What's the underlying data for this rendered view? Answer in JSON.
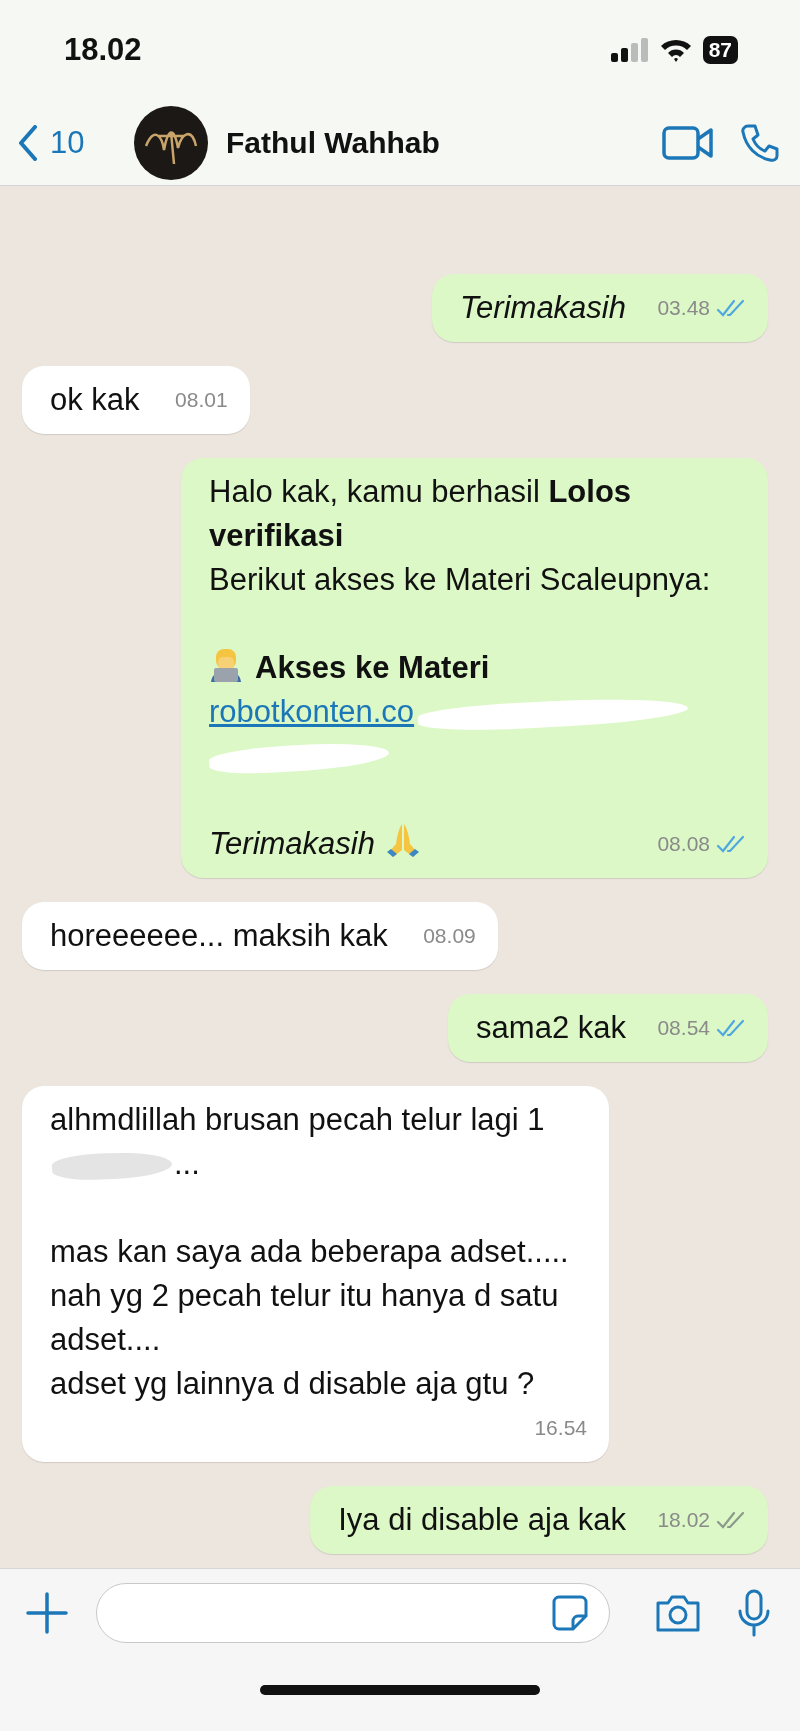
{
  "status_bar": {
    "time": "18.02",
    "battery": "87"
  },
  "header": {
    "back_count": "10",
    "contact_name": "Fathul Wahhab"
  },
  "messages": [
    {
      "kind": "sent",
      "parts": [
        {
          "kind": "italic",
          "text": "Terimakasih"
        }
      ],
      "time": "03.48",
      "read": true
    },
    {
      "kind": "received",
      "parts": [
        {
          "kind": "text",
          "text": "ok kak"
        }
      ],
      "time": "08.01"
    },
    {
      "kind": "sent",
      "parts": [
        {
          "kind": "text",
          "text": "Halo kak, kamu berhasil **Lolos verifikasi**"
        },
        {
          "kind": "text",
          "text": "Berikut akses ke Materi Scaleupnya:"
        },
        {
          "kind": "blank"
        },
        {
          "kind": "heading",
          "text": "Akses ke Materi"
        },
        {
          "kind": "link",
          "text": "robotkonten.co",
          "redacted": true
        },
        {
          "kind": "blank"
        },
        {
          "kind": "thanks",
          "text": "Terimakasih"
        }
      ],
      "time": "08.08",
      "read": true
    },
    {
      "kind": "received",
      "parts": [
        {
          "kind": "text",
          "text": "horeeeeee... maksih kak"
        }
      ],
      "time": "08.09"
    },
    {
      "kind": "sent",
      "parts": [
        {
          "kind": "text",
          "text": "sama2 kak"
        }
      ],
      "time": "08.54",
      "read": true
    },
    {
      "kind": "received",
      "parts": [
        {
          "kind": "text",
          "text": "alhmdlillah brusan pecah telur lagi 1",
          "redacted": true,
          "after": "..."
        },
        {
          "kind": "blank"
        },
        {
          "kind": "text",
          "text": "mas kan saya ada beberapa adset..... nah yg 2 pecah telur itu hanya d satu adset...."
        },
        {
          "kind": "text",
          "text": "adset yg lainnya d disable aja gtu ?"
        }
      ],
      "time": "16.54"
    },
    {
      "kind": "sent",
      "parts": [
        {
          "kind": "text",
          "text": "Iya di disable aja kak"
        }
      ],
      "time": "18.02",
      "read": false
    }
  ]
}
